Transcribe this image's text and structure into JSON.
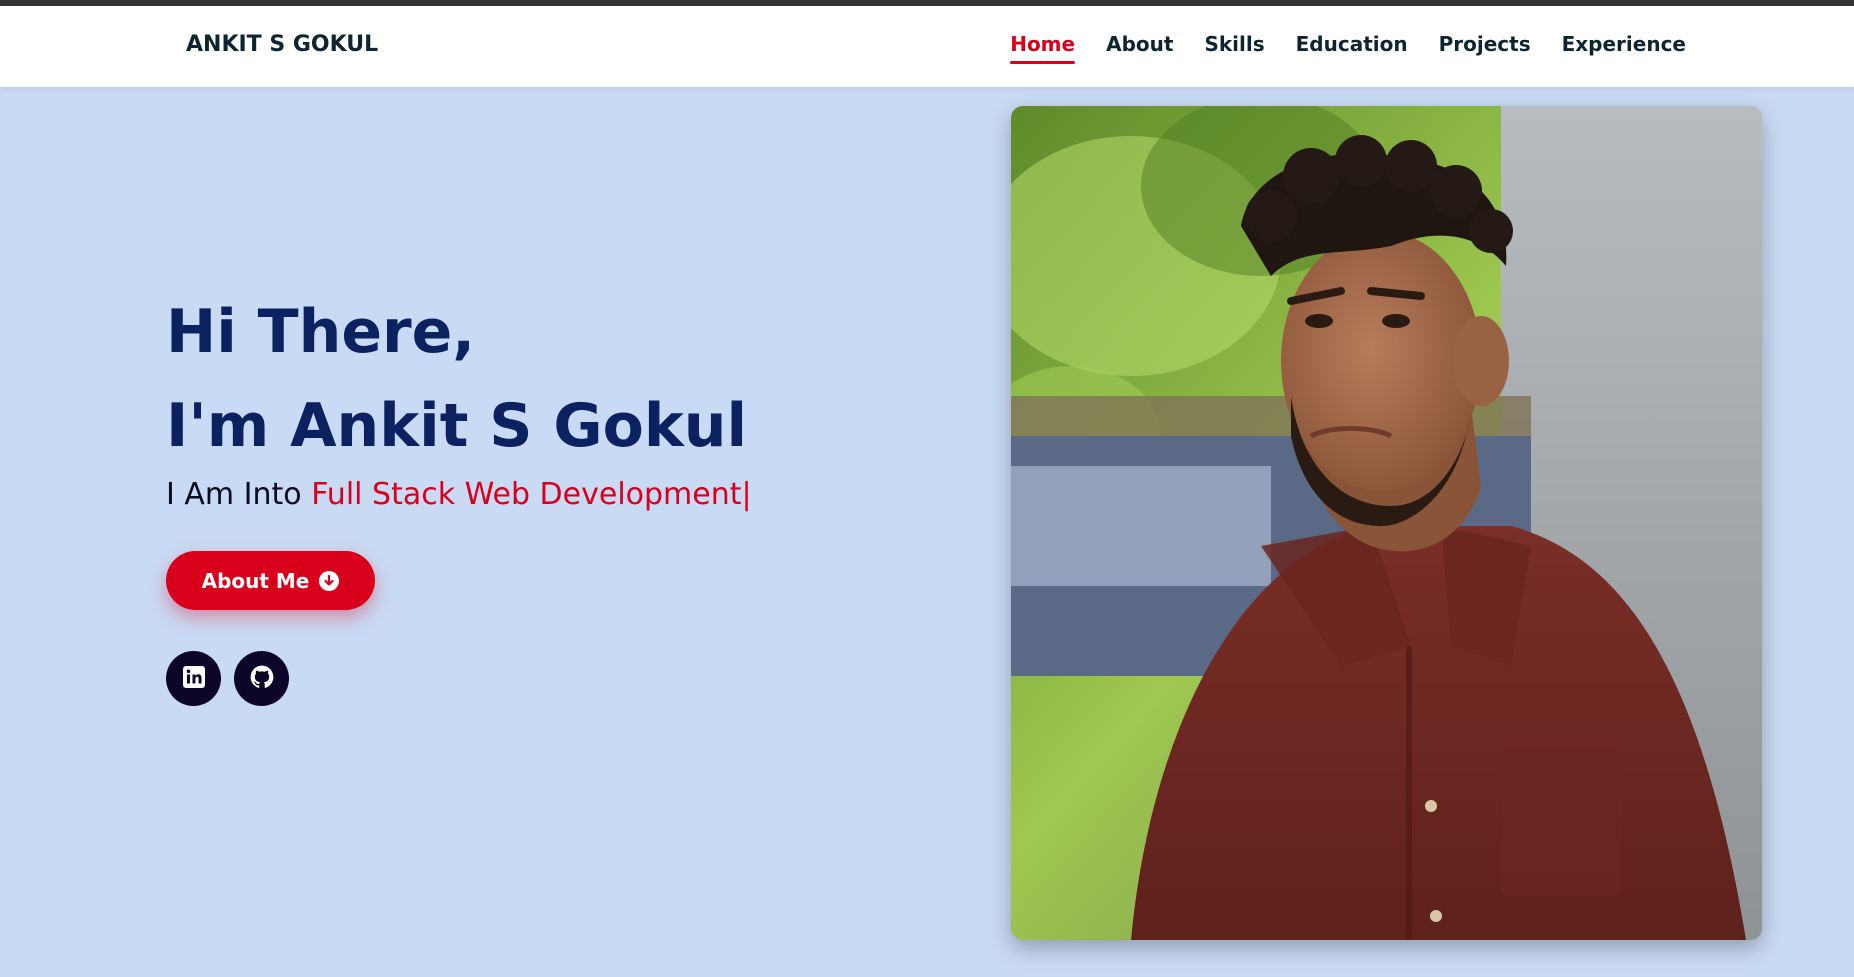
{
  "brand": {
    "name": "ANKIT S GOKUL"
  },
  "nav": {
    "items": [
      {
        "label": "Home",
        "active": true
      },
      {
        "label": "About"
      },
      {
        "label": "Skills"
      },
      {
        "label": "Education"
      },
      {
        "label": "Projects"
      },
      {
        "label": "Experience"
      }
    ]
  },
  "hero": {
    "greeting": "Hi There,",
    "intro": "I'm Ankit S Gokul",
    "sub_prefix": "I Am Into ",
    "typed_text": "Full Stack Web Development|",
    "button_label": "About Me",
    "button_icon": "arrow-down-circle-icon"
  },
  "social": [
    {
      "name": "linkedin-icon"
    },
    {
      "name": "github-icon"
    }
  ],
  "colors": {
    "accent": "#d9001b",
    "heading": "#0b2160",
    "background": "#c9daf4",
    "nav_text": "#0e2431"
  }
}
